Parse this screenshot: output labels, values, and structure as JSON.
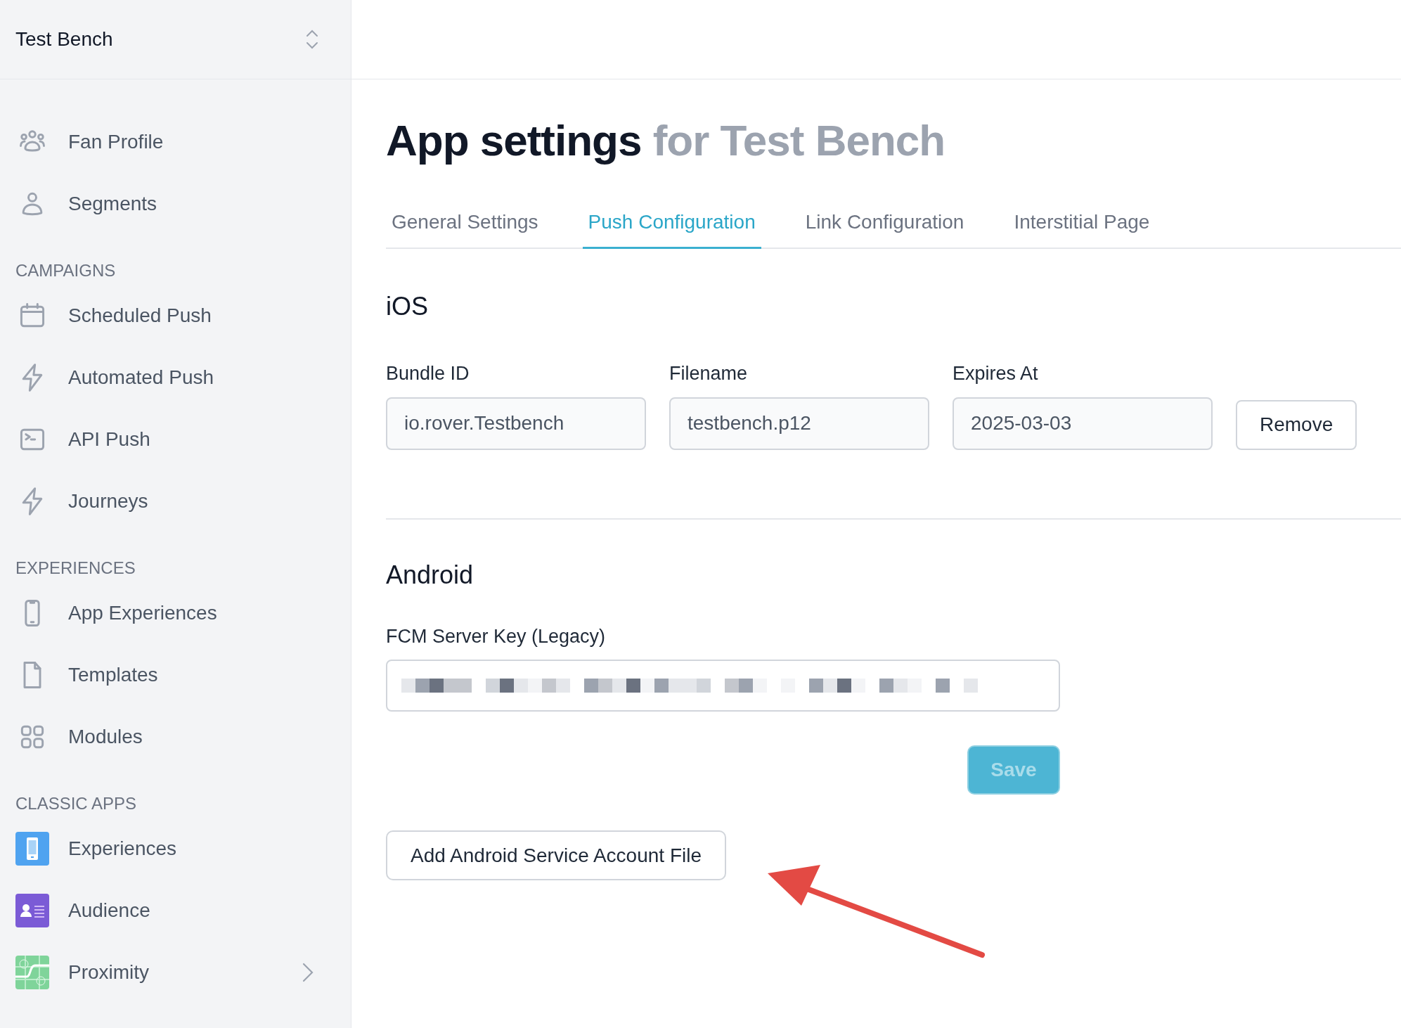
{
  "sidebar": {
    "workspace": "Test Bench",
    "groups": [
      {
        "items": [
          {
            "label": "Fan Profile",
            "kind": "outline",
            "expandable": false
          },
          {
            "label": "Segments",
            "kind": "outline",
            "expandable": false
          }
        ]
      },
      {
        "heading": "CAMPAIGNS",
        "items": [
          {
            "label": "Scheduled Push",
            "kind": "outline",
            "expandable": false
          },
          {
            "label": "Automated Push",
            "kind": "outline",
            "expandable": false
          },
          {
            "label": "API Push",
            "kind": "outline",
            "expandable": false
          },
          {
            "label": "Journeys",
            "kind": "outline",
            "expandable": false
          }
        ]
      },
      {
        "heading": "EXPERIENCES",
        "items": [
          {
            "label": "App Experiences",
            "kind": "outline",
            "expandable": false
          },
          {
            "label": "Templates",
            "kind": "outline",
            "expandable": false
          },
          {
            "label": "Modules",
            "kind": "outline",
            "expandable": false
          }
        ]
      },
      {
        "heading": "CLASSIC APPS",
        "items": [
          {
            "label": "Experiences",
            "kind": "app",
            "color": "#4fa3f0",
            "expandable": false
          },
          {
            "label": "Audience",
            "kind": "app",
            "color": "#7b5bd6",
            "expandable": false
          },
          {
            "label": "Proximity",
            "kind": "app",
            "color": "#7fd49a",
            "expandable": true
          }
        ]
      }
    ]
  },
  "page": {
    "title": "App settings",
    "title_suffix": "for Test Bench",
    "tabs": [
      {
        "label": "General Settings",
        "selected": false
      },
      {
        "label": "Push Configuration",
        "selected": true
      },
      {
        "label": "Link Configuration",
        "selected": false
      },
      {
        "label": "Interstitial Page",
        "selected": false
      }
    ],
    "ios": {
      "heading": "iOS",
      "fields": [
        {
          "label": "Bundle ID",
          "value": "io.rover.Testbench"
        },
        {
          "label": "Filename",
          "value": "testbench.p12"
        },
        {
          "label": "Expires At",
          "value": "2025-03-03"
        }
      ],
      "remove_button": "Remove"
    },
    "android": {
      "heading": "Android",
      "key_label": "FCM Server Key (Legacy)",
      "save_button": {
        "label": "Save",
        "disabled": true
      },
      "add_button": "Add Android Service Account File"
    }
  }
}
